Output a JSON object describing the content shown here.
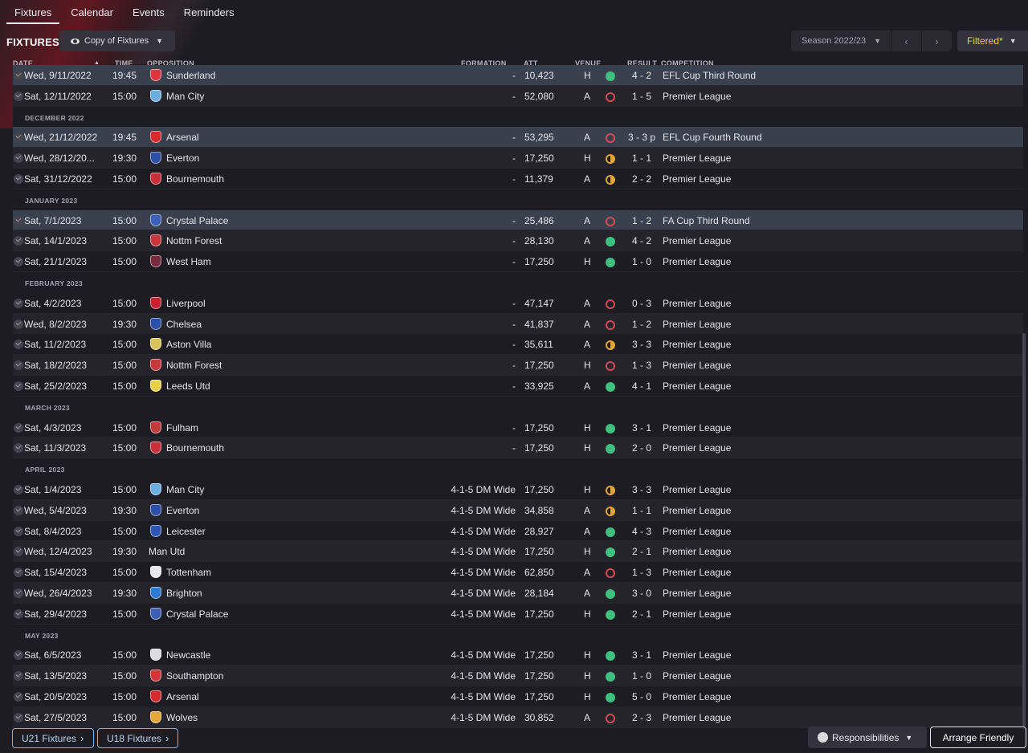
{
  "tabs": [
    "Fixtures",
    "Calendar",
    "Events",
    "Reminders"
  ],
  "page_title": "FIXTURES",
  "view_label": "Copy of Fixtures",
  "season_label": "Season 2022/23",
  "filter_label": "Filtered*",
  "columns": {
    "date": "DATE",
    "time": "TIME",
    "opposition": "OPPOSITION",
    "formation": "FORMATION",
    "att": "ATT",
    "venue": "VENUE",
    "result": "RESULT",
    "competition": "COMPETITION"
  },
  "rows": [
    {
      "kind": "match",
      "date": "Wed, 9/11/2022",
      "time": "19:45",
      "opp": "Sunderland",
      "crest": "#d9383e",
      "form": "-",
      "att": "10,423",
      "venue": "H",
      "outcome": "win",
      "score": "4 - 2",
      "comp": "EFL Cup Third Round",
      "hl": true
    },
    {
      "kind": "match",
      "date": "Sat, 12/11/2022",
      "time": "15:00",
      "opp": "Man City",
      "crest": "#6caee0",
      "form": "-",
      "att": "52,080",
      "venue": "A",
      "outcome": "loss",
      "score": "1 - 5",
      "comp": "Premier League"
    },
    {
      "kind": "section",
      "label": "DECEMBER 2022"
    },
    {
      "kind": "match",
      "date": "Wed, 21/12/2022",
      "time": "19:45",
      "opp": "Arsenal",
      "crest": "#d52b2f",
      "form": "-",
      "att": "53,295",
      "venue": "A",
      "outcome": "loss",
      "score": "3 - 3 p",
      "comp": "EFL Cup Fourth Round",
      "hl": true
    },
    {
      "kind": "match",
      "date": "Wed, 28/12/20...",
      "time": "19:30",
      "opp": "Everton",
      "crest": "#2c4fa8",
      "form": "-",
      "att": "17,250",
      "venue": "H",
      "outcome": "draw",
      "score": "1 - 1",
      "comp": "Premier League"
    },
    {
      "kind": "match",
      "date": "Sat, 31/12/2022",
      "time": "15:00",
      "opp": "Bournemouth",
      "crest": "#c9303a",
      "form": "-",
      "att": "11,379",
      "venue": "A",
      "outcome": "draw",
      "score": "2 - 2",
      "comp": "Premier League"
    },
    {
      "kind": "section",
      "label": "JANUARY 2023"
    },
    {
      "kind": "match",
      "date": "Sat, 7/1/2023",
      "time": "15:00",
      "opp": "Crystal Palace",
      "crest": "#3c60b8",
      "form": "-",
      "att": "25,486",
      "venue": "A",
      "outcome": "loss",
      "score": "1 - 2",
      "comp": "FA Cup Third Round",
      "hl": true
    },
    {
      "kind": "match",
      "date": "Sat, 14/1/2023",
      "time": "15:00",
      "opp": "Nottm Forest",
      "crest": "#c7383c",
      "form": "-",
      "att": "28,130",
      "venue": "A",
      "outcome": "win",
      "score": "4 - 2",
      "comp": "Premier League"
    },
    {
      "kind": "match",
      "date": "Sat, 21/1/2023",
      "time": "15:00",
      "opp": "West Ham",
      "crest": "#7a2a3e",
      "form": "-",
      "att": "17,250",
      "venue": "H",
      "outcome": "win",
      "score": "1 - 0",
      "comp": "Premier League"
    },
    {
      "kind": "section",
      "label": "FEBRUARY 2023"
    },
    {
      "kind": "match",
      "date": "Sat, 4/2/2023",
      "time": "15:00",
      "opp": "Liverpool",
      "crest": "#c8202f",
      "form": "-",
      "att": "47,147",
      "venue": "A",
      "outcome": "loss",
      "score": "0 - 3",
      "comp": "Premier League"
    },
    {
      "kind": "match",
      "date": "Wed, 8/2/2023",
      "time": "19:30",
      "opp": "Chelsea",
      "crest": "#2a4fa6",
      "form": "-",
      "att": "41,837",
      "venue": "A",
      "outcome": "loss",
      "score": "1 - 2",
      "comp": "Premier League"
    },
    {
      "kind": "match",
      "date": "Sat, 11/2/2023",
      "time": "15:00",
      "opp": "Aston Villa",
      "crest": "#d8c35a",
      "form": "-",
      "att": "35,611",
      "venue": "A",
      "outcome": "draw",
      "score": "3 - 3",
      "comp": "Premier League"
    },
    {
      "kind": "match",
      "date": "Sat, 18/2/2023",
      "time": "15:00",
      "opp": "Nottm Forest",
      "crest": "#c7383c",
      "form": "-",
      "att": "17,250",
      "venue": "H",
      "outcome": "loss",
      "score": "1 - 3",
      "comp": "Premier League"
    },
    {
      "kind": "match",
      "date": "Sat, 25/2/2023",
      "time": "15:00",
      "opp": "Leeds Utd",
      "crest": "#e8d04a",
      "form": "-",
      "att": "33,925",
      "venue": "A",
      "outcome": "win",
      "score": "4 - 1",
      "comp": "Premier League"
    },
    {
      "kind": "section",
      "label": "MARCH 2023"
    },
    {
      "kind": "match",
      "date": "Sat, 4/3/2023",
      "time": "15:00",
      "opp": "Fulham",
      "crest": "#c43a3c",
      "form": "-",
      "att": "17,250",
      "venue": "H",
      "outcome": "win",
      "score": "3 - 1",
      "comp": "Premier League"
    },
    {
      "kind": "match",
      "date": "Sat, 11/3/2023",
      "time": "15:00",
      "opp": "Bournemouth",
      "crest": "#c9303a",
      "form": "-",
      "att": "17,250",
      "venue": "H",
      "outcome": "win",
      "score": "2 - 0",
      "comp": "Premier League"
    },
    {
      "kind": "section",
      "label": "APRIL 2023"
    },
    {
      "kind": "match",
      "date": "Sat, 1/4/2023",
      "time": "15:00",
      "opp": "Man City",
      "crest": "#6caee0",
      "form": "4-1-5 DM Wide",
      "att": "17,250",
      "venue": "H",
      "outcome": "draw",
      "score": "3 - 3",
      "comp": "Premier League"
    },
    {
      "kind": "match",
      "date": "Wed, 5/4/2023",
      "time": "19:30",
      "opp": "Everton",
      "crest": "#2c4fa8",
      "form": "4-1-5 DM Wide",
      "att": "34,858",
      "venue": "A",
      "outcome": "draw",
      "score": "1 - 1",
      "comp": "Premier League"
    },
    {
      "kind": "match",
      "date": "Sat, 8/4/2023",
      "time": "15:00",
      "opp": "Leicester",
      "crest": "#2d57b5",
      "form": "4-1-5 DM Wide",
      "att": "28,927",
      "venue": "A",
      "outcome": "win",
      "score": "4 - 3",
      "comp": "Premier League"
    },
    {
      "kind": "match",
      "date": "Wed, 12/4/2023",
      "time": "19:30",
      "opp": "Man Utd",
      "crest": "",
      "form": "4-1-5 DM Wide",
      "att": "17,250",
      "venue": "H",
      "outcome": "win",
      "score": "2 - 1",
      "comp": "Premier League"
    },
    {
      "kind": "match",
      "date": "Sat, 15/4/2023",
      "time": "15:00",
      "opp": "Tottenham",
      "crest": "#e8e8ec",
      "form": "4-1-5 DM Wide",
      "att": "62,850",
      "venue": "A",
      "outcome": "loss",
      "score": "1 - 3",
      "comp": "Premier League"
    },
    {
      "kind": "match",
      "date": "Wed, 26/4/2023",
      "time": "19:30",
      "opp": "Brighton",
      "crest": "#2f7ad0",
      "form": "4-1-5 DM Wide",
      "att": "28,184",
      "venue": "A",
      "outcome": "win",
      "score": "3 - 0",
      "comp": "Premier League"
    },
    {
      "kind": "match",
      "date": "Sat, 29/4/2023",
      "time": "15:00",
      "opp": "Crystal Palace",
      "crest": "#3c60b8",
      "form": "4-1-5 DM Wide",
      "att": "17,250",
      "venue": "H",
      "outcome": "win",
      "score": "2 - 1",
      "comp": "Premier League"
    },
    {
      "kind": "section",
      "label": "MAY 2023"
    },
    {
      "kind": "match",
      "date": "Sat, 6/5/2023",
      "time": "15:00",
      "opp": "Newcastle",
      "crest": "#dcdce0",
      "form": "4-1-5 DM Wide",
      "att": "17,250",
      "venue": "H",
      "outcome": "win",
      "score": "3 - 1",
      "comp": "Premier League"
    },
    {
      "kind": "match",
      "date": "Sat, 13/5/2023",
      "time": "15:00",
      "opp": "Southampton",
      "crest": "#d2353a",
      "form": "4-1-5 DM Wide",
      "att": "17,250",
      "venue": "H",
      "outcome": "win",
      "score": "1 - 0",
      "comp": "Premier League"
    },
    {
      "kind": "match",
      "date": "Sat, 20/5/2023",
      "time": "15:00",
      "opp": "Arsenal",
      "crest": "#d52b2f",
      "form": "4-1-5 DM Wide",
      "att": "17,250",
      "venue": "H",
      "outcome": "win",
      "score": "5 - 0",
      "comp": "Premier League"
    },
    {
      "kind": "match",
      "date": "Sat, 27/5/2023",
      "time": "15:00",
      "opp": "Wolves",
      "crest": "#e3a73a",
      "form": "4-1-5 DM Wide",
      "att": "30,852",
      "venue": "A",
      "outcome": "loss",
      "score": "2 - 3",
      "comp": "Premier League"
    }
  ],
  "footer": {
    "u21": "U21 Fixtures",
    "u18": "U18 Fixtures",
    "responsibilities": "Responsibilities",
    "arrange": "Arrange Friendly"
  }
}
